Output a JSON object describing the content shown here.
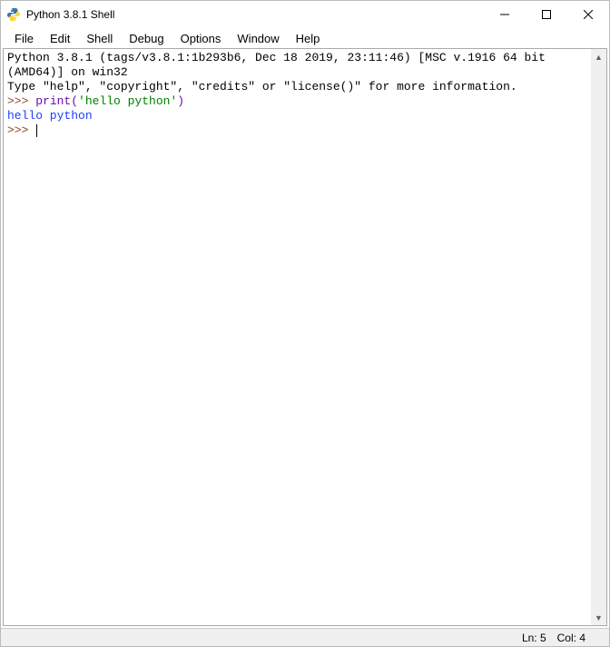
{
  "window": {
    "title": "Python 3.8.1 Shell"
  },
  "menu": {
    "file": "File",
    "edit": "Edit",
    "shell": "Shell",
    "debug": "Debug",
    "options": "Options",
    "window": "Window",
    "help": "Help"
  },
  "shell": {
    "banner_line1": "Python 3.8.1 (tags/v3.8.1:1b293b6, Dec 18 2019, 23:11:46) [MSC v.1916 64 bit (AMD64)] on win32",
    "banner_line2": "Type \"help\", \"copyright\", \"credits\" or \"license()\" for more information.",
    "prompt": ">>> ",
    "call_fn": "print",
    "call_open": "(",
    "call_arg": "'hello python'",
    "call_close": ")",
    "output1": "hello python"
  },
  "status": {
    "ln": "Ln: 5",
    "col": "Col: 4"
  },
  "scroll": {
    "up": "▲",
    "down": "▼"
  }
}
